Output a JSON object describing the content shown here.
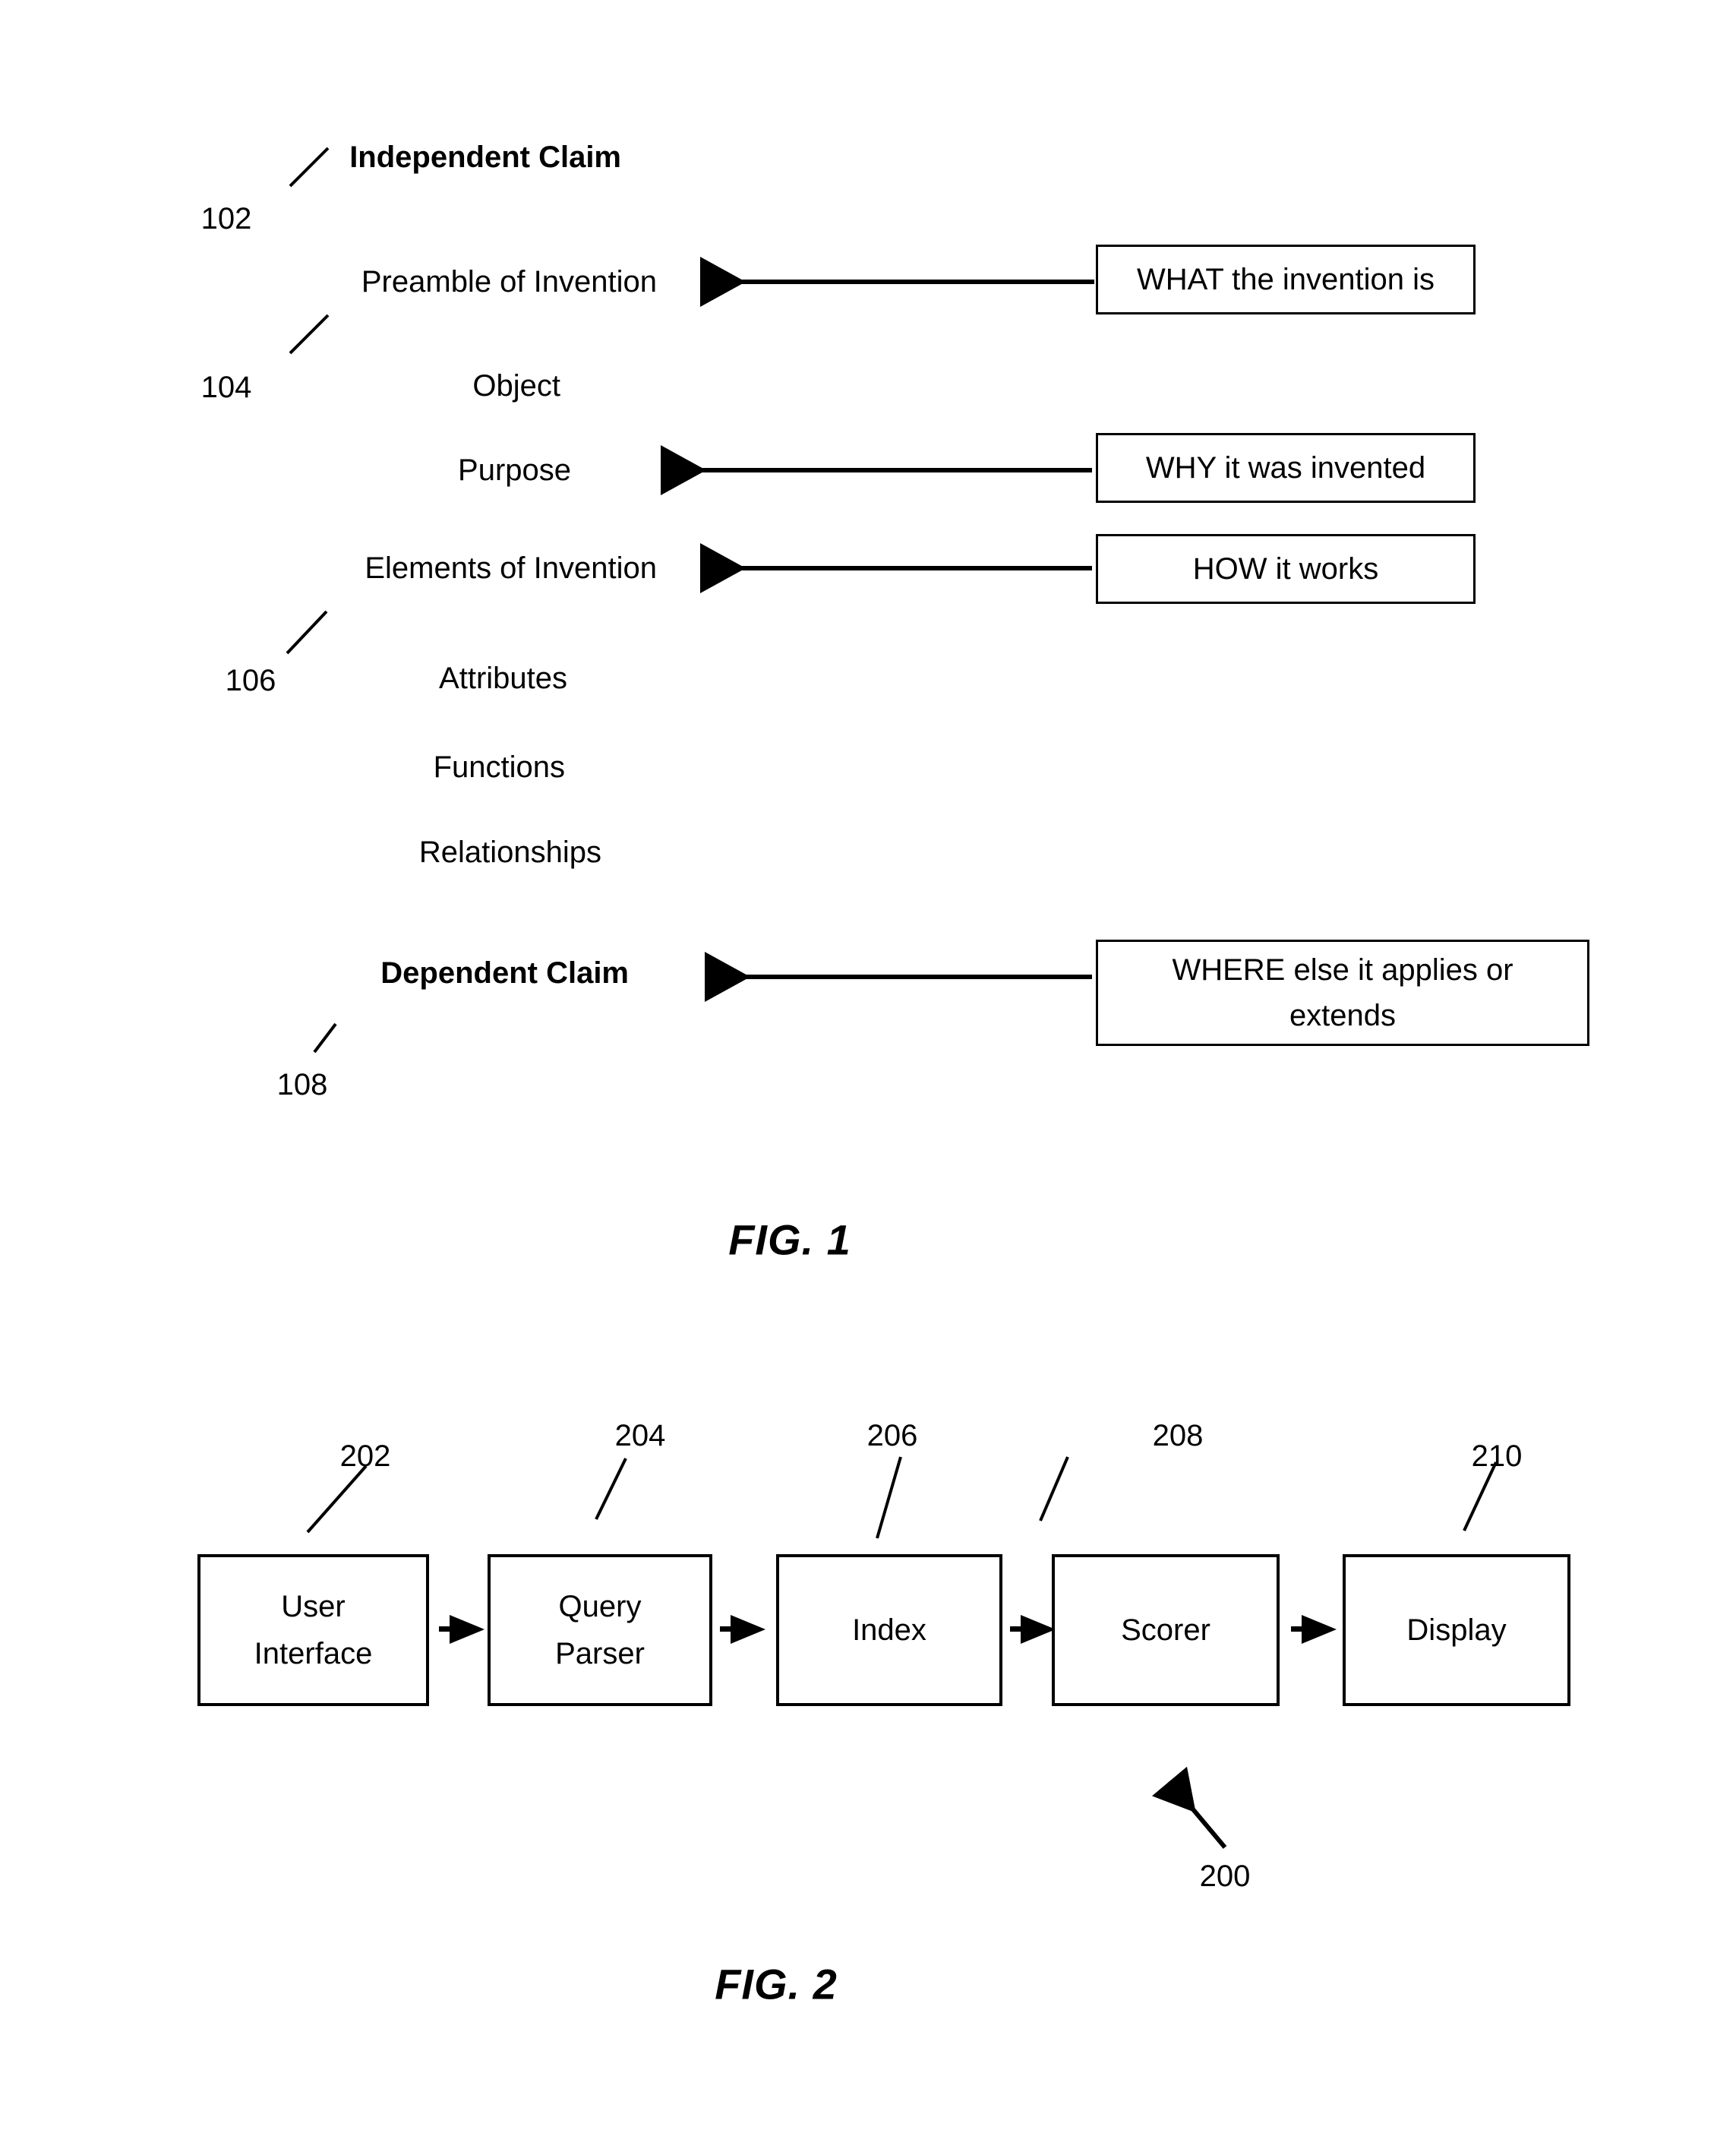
{
  "document": {
    "type": "patent-drawing-sheet",
    "background_color": "#ffffff",
    "ink_color": "#000000"
  },
  "figure1": {
    "caption": "FIG. 1",
    "hierarchy": [
      {
        "label": "Independent Claim",
        "bold": true
      },
      {
        "label": "Preamble of Invention",
        "bold": false
      },
      {
        "label": "Object",
        "bold": false
      },
      {
        "label": "Purpose",
        "bold": false
      },
      {
        "label": "Elements of Invention",
        "bold": false
      },
      {
        "label": "Attributes",
        "bold": false
      },
      {
        "label": "Functions",
        "bold": false
      },
      {
        "label": "Relationships",
        "bold": false
      },
      {
        "label": "Dependent Claim",
        "bold": true
      }
    ],
    "reference_numerals": [
      {
        "id": "102",
        "points_to": "Independent Claim"
      },
      {
        "id": "104",
        "points_to": "Preamble of Invention"
      },
      {
        "id": "106",
        "points_to": "Elements of Invention"
      },
      {
        "id": "108",
        "points_to": "Dependent Claim"
      }
    ],
    "annotation_boxes": [
      {
        "text": "WHAT the invention is",
        "targets": "Preamble of Invention"
      },
      {
        "text": "WHY it was invented",
        "targets": "Purpose"
      },
      {
        "text": "HOW it works",
        "targets": "Elements of Invention"
      },
      {
        "line1": "WHERE else it applies or",
        "line2": "extends",
        "targets": "Dependent Claim"
      }
    ]
  },
  "figure2": {
    "caption": "FIG. 2",
    "system_numeral": "200",
    "pipeline": [
      {
        "numeral": "202",
        "line1": "User",
        "line2": "Interface"
      },
      {
        "numeral": "204",
        "line1": "Query",
        "line2": "Parser"
      },
      {
        "numeral": "206",
        "line1": "Index",
        "line2": ""
      },
      {
        "numeral": "208",
        "line1": "Scorer",
        "line2": ""
      },
      {
        "numeral": "210",
        "line1": "Display",
        "line2": ""
      }
    ]
  }
}
